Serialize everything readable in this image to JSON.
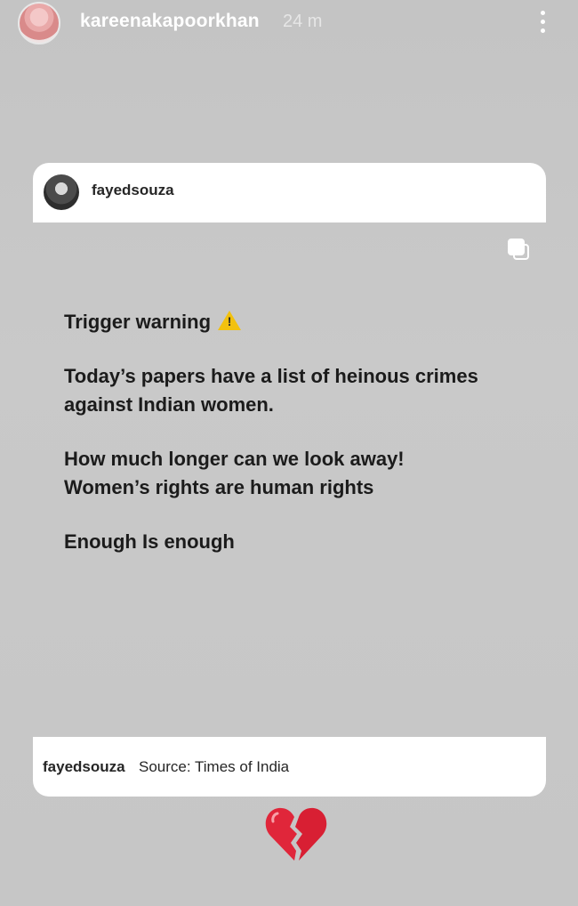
{
  "story": {
    "username": "kareenakapoorkhan",
    "time": "24 m",
    "more_icon": "more-vertical-icon"
  },
  "post": {
    "username": "fayedsouza",
    "copy_icon": "copy-icon"
  },
  "message": {
    "line1": "Trigger warning",
    "warning_icon": "warning-icon",
    "warning_mark": "!",
    "para2": [
      "Today’s papers have a list of heinous crimes",
      "against Indian women."
    ],
    "para3": [
      "How much longer can we look away!",
      "Women’s rights are human rights"
    ],
    "para4": "Enough Is enough"
  },
  "caption": {
    "username": "fayedsouza",
    "text": "Source: Times of India"
  },
  "sticker": "broken-heart-icon",
  "colors": {
    "background": "#c7c7c7",
    "card": "#ffffff",
    "warning": "#f2c10f",
    "heart": "#e0263a"
  }
}
